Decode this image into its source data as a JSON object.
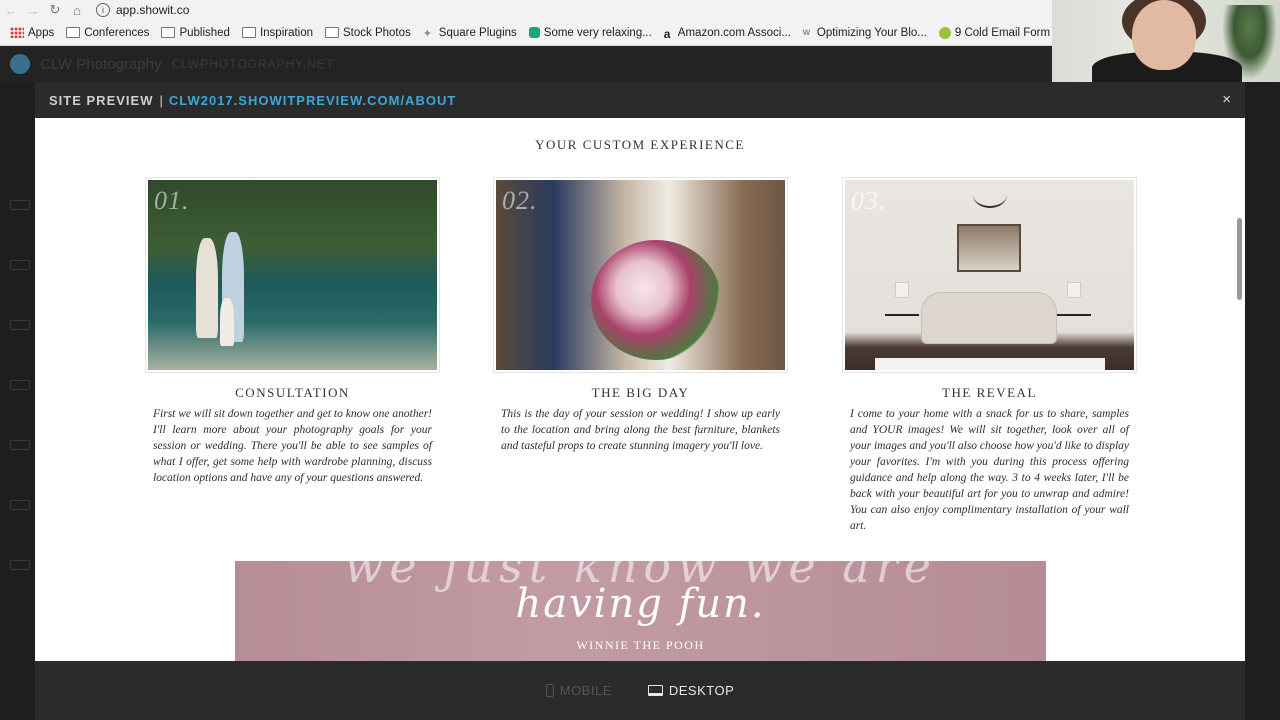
{
  "browser": {
    "url": "app.showit.co",
    "bookmarks": [
      {
        "label": "Apps",
        "icon": "apps-grid-icon"
      },
      {
        "label": "Conferences",
        "icon": "folder-icon"
      },
      {
        "label": "Published",
        "icon": "folder-icon"
      },
      {
        "label": "Inspiration",
        "icon": "folder-icon"
      },
      {
        "label": "Stock Photos",
        "icon": "folder-icon"
      },
      {
        "label": "Square Plugins",
        "icon": "puzzle-icon"
      },
      {
        "label": "Some very relaxing...",
        "icon": "site-icon"
      },
      {
        "label": "Amazon.com Associ...",
        "icon": "amazon-icon"
      },
      {
        "label": "Optimizing Your Blo...",
        "icon": "site-icon"
      },
      {
        "label": "9 Cold Email Form",
        "icon": "yoast-icon"
      }
    ]
  },
  "editor": {
    "site_name": "CLW Photography",
    "site_domain": "CLWPHOTOGRAPHY.NET"
  },
  "modal": {
    "label": "SITE PREVIEW",
    "separator": "|",
    "url": "CLW2017.SHOWITPREVIEW.COM/ABOUT",
    "close": "×"
  },
  "page": {
    "section_title": "YOUR CUSTOM EXPERIENCE",
    "cards": [
      {
        "number": "01.",
        "title": "CONSULTATION",
        "text": "First we will sit down together and get to know one another! I'll learn more about your photography goals for your session or wedding. There you'll be able to see samples of what I offer, get some help with wardrobe planning, discuss location options and have any of your questions answered."
      },
      {
        "number": "02.",
        "title": "THE BIG DAY",
        "text": "This is the day of your session or wedding! I show up early to the location and bring along the best furniture, blankets and tasteful props to create stunning imagery you'll love."
      },
      {
        "number": "03.",
        "title": "THE REVEAL",
        "text": "I come to your home with a snack for us to share, samples and YOUR images! We will sit together, look over all of your images and you'll also choose how you'd like to display your favorites. I'm with you during this process offering guidance and help along the way. 3 to 4 weeks later, I'll be back with your beautiful art for you to unwrap and admire! You can also enjoy complimentary installation of your wall art."
      }
    ],
    "quote": {
      "ghost_line": "we just know we are",
      "main_line": "having fun.",
      "author": "WINNIE THE POOH"
    }
  },
  "footer": {
    "mobile_label": "MOBILE",
    "desktop_label": "DESKTOP",
    "active": "desktop"
  },
  "colors": {
    "accent_url": "#3ea6d8",
    "quote_bg": "#b68d97"
  }
}
